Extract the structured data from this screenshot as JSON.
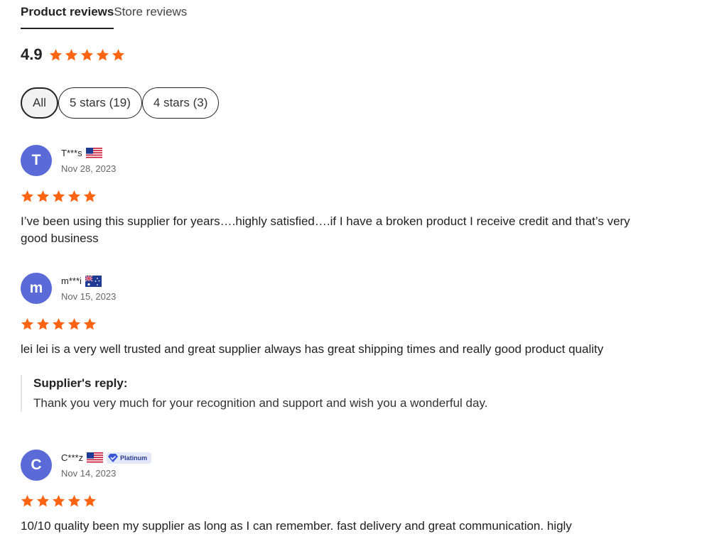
{
  "tabs": [
    {
      "label": "Product reviews",
      "active": true
    },
    {
      "label": "Store reviews",
      "active": false
    }
  ],
  "summary": {
    "rating": "4.9",
    "stars": 5
  },
  "filters": [
    {
      "label": "All",
      "selected": true
    },
    {
      "label": "5 stars (19)",
      "selected": false
    },
    {
      "label": "4 stars (3)",
      "selected": false
    }
  ],
  "colors": {
    "star": "#fe6411",
    "avatar": "#5a6ad6"
  },
  "reviews": [
    {
      "initial": "T",
      "name": "T***s",
      "flag": "us-flag-icon",
      "date": "Nov 28, 2023",
      "stars": 5,
      "text": "I’ve been using this supplier for years….highly satisfied….if I have a broken product I receive credit and that’s very good business"
    },
    {
      "initial": "m",
      "name": "m***i",
      "flag": "au-flag-icon",
      "date": "Nov 15, 2023",
      "stars": 5,
      "text": "lei lei is a very well trusted and great supplier always has great shipping times and really good product quality",
      "reply": {
        "title": "Supplier's reply:",
        "text": "Thank you very much for your recognition and support and wish you a wonderful day."
      }
    },
    {
      "initial": "C",
      "name": "C***z",
      "flag": "us-flag-icon",
      "badge": "Platinum",
      "date": "Nov 14, 2023",
      "stars": 5,
      "text": "10/10 quality been my supplier as long as I can remember. fast delivery and great communication. higly"
    }
  ]
}
